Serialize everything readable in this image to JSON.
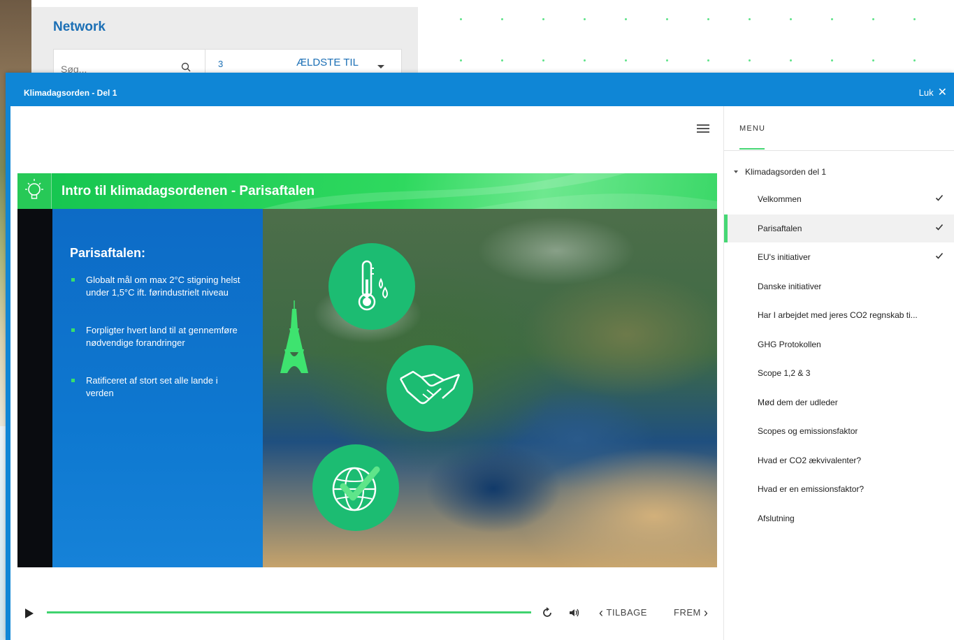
{
  "background": {
    "title": "Network",
    "search_placeholder": "Søg...",
    "count": "3",
    "sort_label": "ÆLDSTE TIL"
  },
  "modal": {
    "title": "Klimadagsorden - Del 1",
    "close_label": "Luk"
  },
  "slide": {
    "title": "Intro til klimadagsordenen - Parisaftalen",
    "heading": "Parisaftalen:",
    "bullets": [
      "Globalt mål om max 2°C stigning helst under 1,5°C ift. førindustrielt niveau",
      "Forpligter hvert land til at gennemføre nødvendige forandringer",
      "Ratificeret af stort set alle lande i verden"
    ],
    "icons": [
      "thermometer-icon",
      "handshake-icon",
      "globe-check-icon"
    ]
  },
  "player": {
    "back_label": "TILBAGE",
    "forward_label": "FREM",
    "progress": 1.0
  },
  "menu": {
    "label": "MENU",
    "section": "Klimadagsorden del 1",
    "items": [
      {
        "label": "Velkommen",
        "done": true
      },
      {
        "label": "Parisaftalen",
        "done": true
      },
      {
        "label": "EU's initiativer",
        "done": true
      },
      {
        "label": "Danske initiativer",
        "done": false
      },
      {
        "label": "Har I arbejdet med jeres CO2 regnskab ti...",
        "done": false
      },
      {
        "label": "GHG Protokollen",
        "done": false
      },
      {
        "label": "Scope 1,2 & 3",
        "done": false
      },
      {
        "label": "Mød dem der udleder",
        "done": false
      },
      {
        "label": "Scopes og emissionsfaktor",
        "done": false
      },
      {
        "label": "Hvad er CO2 ækvivalenter?",
        "done": false
      },
      {
        "label": "Hvad er en emissionsfaktor?",
        "done": false
      },
      {
        "label": "Afslutning",
        "done": false
      }
    ],
    "active_index": 1
  },
  "colors": {
    "header_blue": "#0f86d6",
    "accent_green": "#46d774",
    "slide_blue": "#0e78d0",
    "icon_green": "#1cbc72"
  }
}
